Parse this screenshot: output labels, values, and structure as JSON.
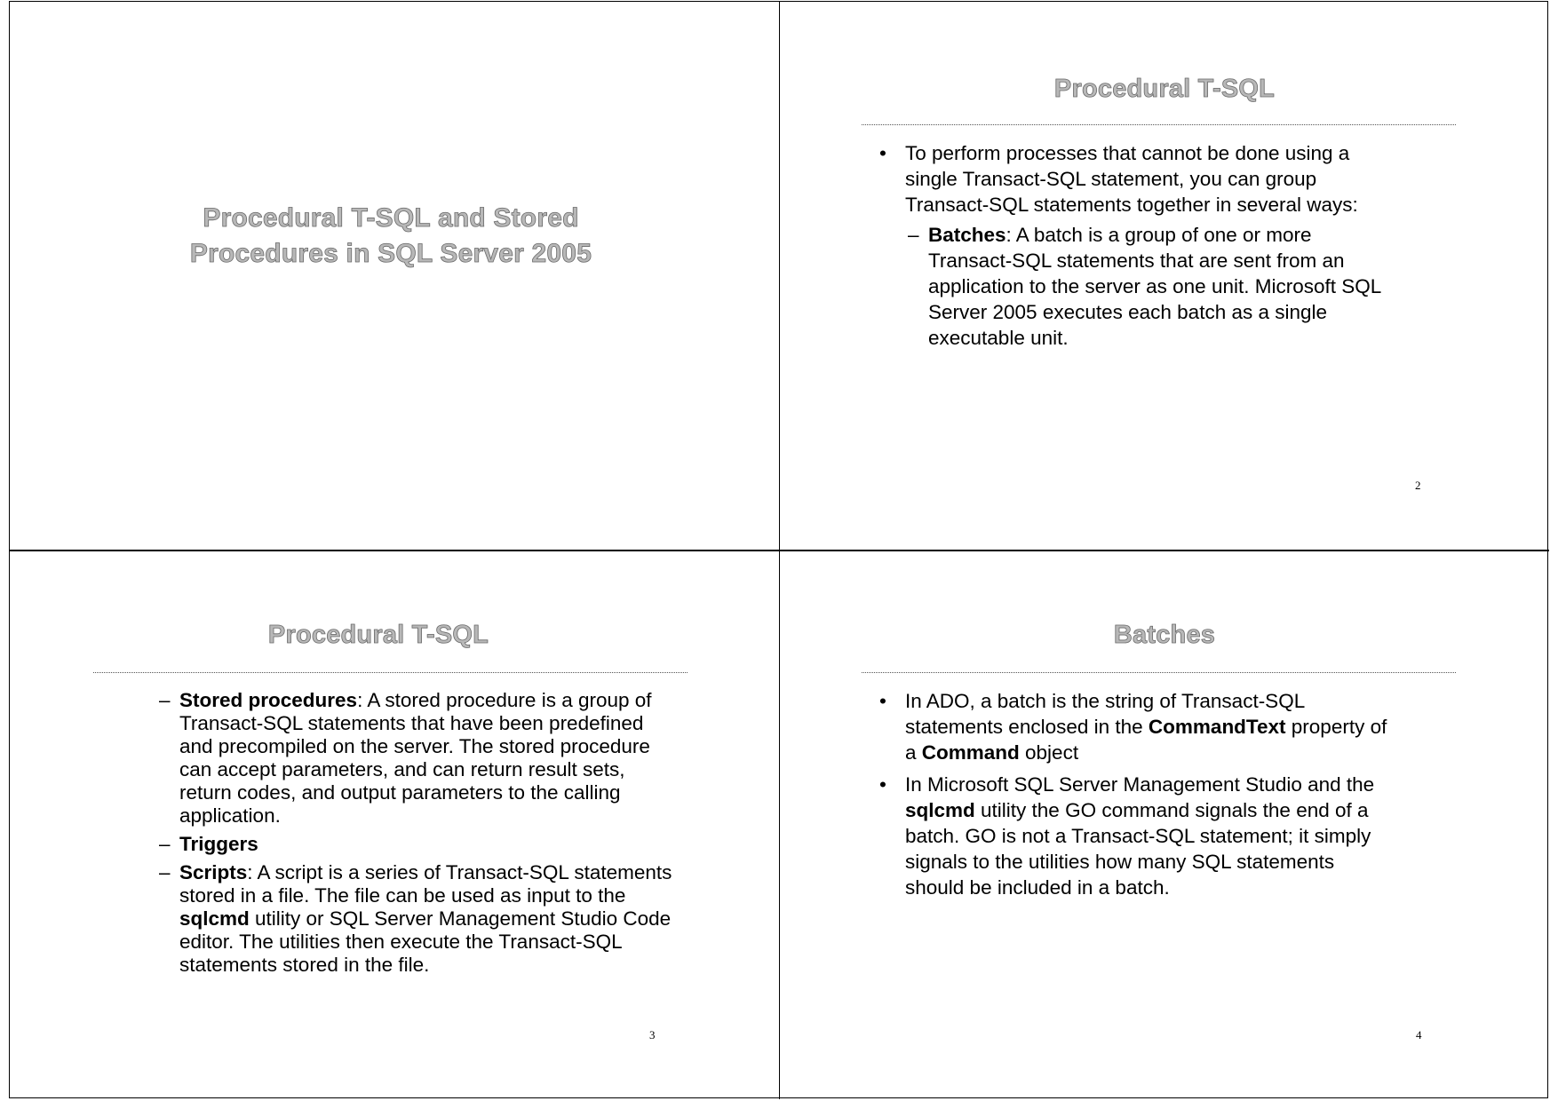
{
  "document": {
    "layout": "4 slides per page handout",
    "slides": [
      {
        "number": "",
        "title_lines": [
          "Procedural T-SQL and Stored",
          "Procedures in SQL Server 2005"
        ]
      },
      {
        "number": "2",
        "title": "Procedural T-SQL",
        "items": [
          {
            "level": 1,
            "marker": "•",
            "segments": [
              {
                "text": "To perform processes that cannot be done using a single Transact-SQL statement, you can group Transact-SQL statements together in several ways:",
                "bold": false
              }
            ]
          },
          {
            "level": 2,
            "marker": "–",
            "segments": [
              {
                "text": "Batches",
                "bold": true
              },
              {
                "text": ": A batch is a group of one or more Transact-SQL statements that are sent from an application to the server as one unit. Microsoft SQL Server 2005 executes each batch as a single executable unit.",
                "bold": false
              }
            ]
          }
        ]
      },
      {
        "number": "3",
        "title": "Procedural T-SQL",
        "items": [
          {
            "level": 2,
            "marker": "–",
            "segments": [
              {
                "text": "Stored procedures",
                "bold": true
              },
              {
                "text": ":  A stored procedure is a group of Transact-SQL statements that have been predefined and precompiled on the server. The stored procedure can accept parameters, and can return result sets, return codes, and output parameters to the calling application.",
                "bold": false
              }
            ]
          },
          {
            "level": 2,
            "marker": "–",
            "segments": [
              {
                "text": "Triggers",
                "bold": true
              }
            ]
          },
          {
            "level": 2,
            "marker": "–",
            "segments": [
              {
                "text": "Scripts",
                "bold": true
              },
              {
                "text": ": A script is a series of Transact-SQL statements stored in a file. The file can be used as input to the ",
                "bold": false
              },
              {
                "text": "sqlcmd",
                "bold": true
              },
              {
                "text": " utility or SQL Server Management Studio Code editor. The utilities then execute the Transact-SQL statements stored in the file.",
                "bold": false
              }
            ]
          }
        ]
      },
      {
        "number": "4",
        "title": "Batches",
        "items": [
          {
            "level": 1,
            "marker": "•",
            "segments": [
              {
                "text": "In ADO, a batch is the string of Transact-SQL statements enclosed in the ",
                "bold": false
              },
              {
                "text": "CommandText",
                "bold": true
              },
              {
                "text": " property of a ",
                "bold": false
              },
              {
                "text": "Command",
                "bold": true
              },
              {
                "text": " object",
                "bold": false
              }
            ]
          },
          {
            "level": 1,
            "marker": "•",
            "segments": [
              {
                "text": "In Microsoft SQL Server Management Studio and the ",
                "bold": false
              },
              {
                "text": "sqlcmd",
                "bold": true
              },
              {
                "text": " utility the GO command signals the end of a batch. GO is not a Transact-SQL statement; it simply signals to the utilities how many SQL statements should be included in a batch.",
                "bold": false
              }
            ]
          }
        ]
      }
    ]
  }
}
